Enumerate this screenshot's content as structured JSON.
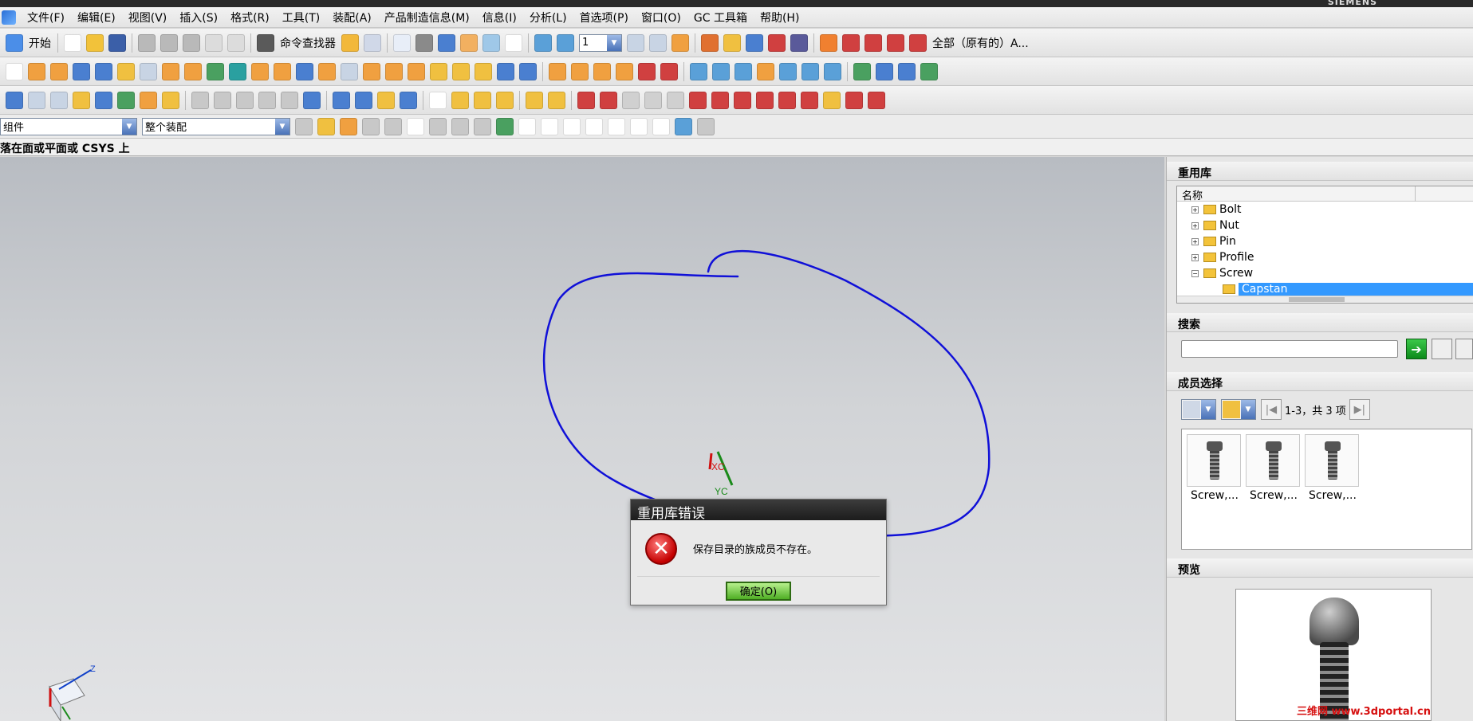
{
  "titlebar": {
    "brand": "SIEMENS"
  },
  "menu": [
    "文件(F)",
    "编辑(E)",
    "视图(V)",
    "插入(S)",
    "格式(R)",
    "工具(T)",
    "装配(A)",
    "产品制造信息(M)",
    "信息(I)",
    "分析(L)",
    "首选项(P)",
    "窗口(O)",
    "GC 工具箱",
    "帮助(H)"
  ],
  "toolbar": {
    "start_label": "开始",
    "command_finder_label": "命令查找器",
    "layer_value": "1",
    "filter_scope_label": "全部（原有的）A..."
  },
  "selection_bar": {
    "type_filter": "组件",
    "scope_filter": "整个装配"
  },
  "cue_line": "落在面或平面或 CSYS 上",
  "viewport": {
    "wcs_x_label": "XC",
    "wcs_y_label": "YC",
    "triad_z_label": "Z",
    "annotation_color": "#1010d8"
  },
  "dialog": {
    "title": "重用库错误",
    "message": "保存目录的族成员不存在。",
    "ok_label": "确定(O)"
  },
  "reuse_library": {
    "title": "重用库",
    "column_name": "名称",
    "items": [
      {
        "label": "Bolt",
        "expander": "+"
      },
      {
        "label": "Nut",
        "expander": "+"
      },
      {
        "label": "Pin",
        "expander": "+"
      },
      {
        "label": "Profile",
        "expander": "+"
      },
      {
        "label": "Screw",
        "expander": "−"
      },
      {
        "label": "Capstan",
        "selected": true
      }
    ]
  },
  "search": {
    "title": "搜索",
    "value": ""
  },
  "member_select": {
    "title": "成员选择",
    "page_info": "1-3，共 3 项",
    "members": [
      "Screw,...",
      "Screw,...",
      "Screw,..."
    ]
  },
  "preview": {
    "title": "预览"
  },
  "watermark": "三维网 www.3dportal.cn"
}
